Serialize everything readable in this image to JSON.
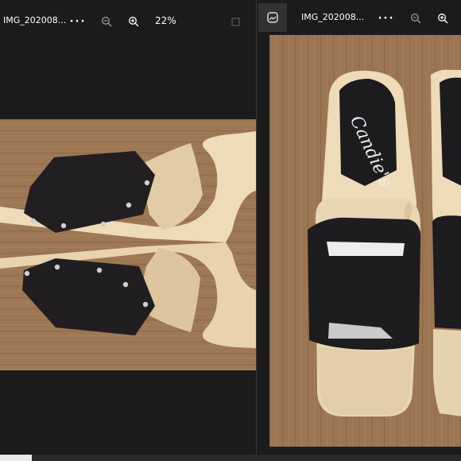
{
  "left_window": {
    "title": "IMG_202008...",
    "more_glyph": "···",
    "zoom_out_icon": "zoom-out-icon",
    "zoom_in_icon": "zoom-in-icon",
    "zoom_level": "22%",
    "restore_icon": "restore-icon",
    "photo_description": "sandals-side-view"
  },
  "right_window": {
    "app_icon": "photos-app-icon",
    "title": "IMG_202008...",
    "more_glyph": "···",
    "zoom_out_icon": "zoom-out-icon",
    "zoom_in_icon": "zoom-in-icon",
    "brand_text": "Candie's",
    "photo_description": "sandals-top-view"
  },
  "colors": {
    "window_bg": "#1b1b1b",
    "wood": "#9b7451",
    "strap": "#1f1d1f",
    "sole": "#e7d5b3",
    "heel": "#eedbb8"
  }
}
